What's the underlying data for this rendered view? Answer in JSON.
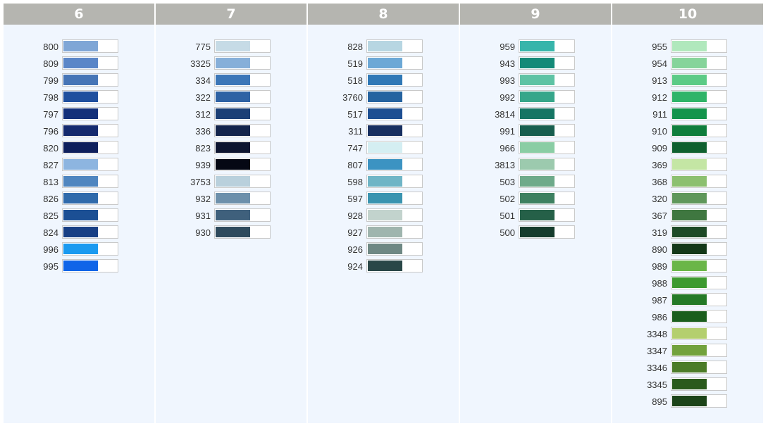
{
  "columns": [
    {
      "title": "6",
      "items": [
        {
          "code": "800",
          "color": "#7fa6d6"
        },
        {
          "code": "809",
          "color": "#5a86c8"
        },
        {
          "code": "799",
          "color": "#4675b6"
        },
        {
          "code": "798",
          "color": "#1f4f9e"
        },
        {
          "code": "797",
          "color": "#13307a"
        },
        {
          "code": "796",
          "color": "#152a6e"
        },
        {
          "code": "820",
          "color": "#0e1f5c"
        },
        {
          "code": "827",
          "color": "#8db5e0"
        },
        {
          "code": "813",
          "color": "#4f86c0"
        },
        {
          "code": "826",
          "color": "#2f6aab"
        },
        {
          "code": "825",
          "color": "#1b4f94"
        },
        {
          "code": "824",
          "color": "#183f84"
        },
        {
          "code": "996",
          "color": "#1a9af0"
        },
        {
          "code": "995",
          "color": "#1065e8"
        }
      ]
    },
    {
      "title": "7",
      "items": [
        {
          "code": "775",
          "color": "#c6dbe6"
        },
        {
          "code": "3325",
          "color": "#86afd9"
        },
        {
          "code": "334",
          "color": "#3b76b8"
        },
        {
          "code": "322",
          "color": "#2e62a4"
        },
        {
          "code": "312",
          "color": "#1b3f76"
        },
        {
          "code": "336",
          "color": "#13244c"
        },
        {
          "code": "823",
          "color": "#0c1430"
        },
        {
          "code": "939",
          "color": "#050814"
        },
        {
          "code": "3753",
          "color": "#b9d0dc"
        },
        {
          "code": "932",
          "color": "#6d90ab"
        },
        {
          "code": "931",
          "color": "#3f607c"
        },
        {
          "code": "930",
          "color": "#2e4a5c"
        }
      ]
    },
    {
      "title": "8",
      "items": [
        {
          "code": "828",
          "color": "#b7d6e2"
        },
        {
          "code": "519",
          "color": "#6ca8d6"
        },
        {
          "code": "518",
          "color": "#2f78b6"
        },
        {
          "code": "3760",
          "color": "#2563a0"
        },
        {
          "code": "517",
          "color": "#1d4f92"
        },
        {
          "code": "311",
          "color": "#172f60"
        },
        {
          "code": "747",
          "color": "#d4eef2"
        },
        {
          "code": "807",
          "color": "#3c93c2"
        },
        {
          "code": "598",
          "color": "#6fb5c6"
        },
        {
          "code": "597",
          "color": "#3a94b0"
        },
        {
          "code": "928",
          "color": "#c2d3cd"
        },
        {
          "code": "927",
          "color": "#9fb5ae"
        },
        {
          "code": "926",
          "color": "#6e8884"
        },
        {
          "code": "924",
          "color": "#2a4748"
        }
      ]
    },
    {
      "title": "9",
      "items": [
        {
          "code": "959",
          "color": "#37b5ab"
        },
        {
          "code": "943",
          "color": "#148a78"
        },
        {
          "code": "993",
          "color": "#5ec3a4"
        },
        {
          "code": "992",
          "color": "#36a68a"
        },
        {
          "code": "3814",
          "color": "#157564"
        },
        {
          "code": "991",
          "color": "#185e4e"
        },
        {
          "code": "966",
          "color": "#8acda4"
        },
        {
          "code": "3813",
          "color": "#9ccaae"
        },
        {
          "code": "503",
          "color": "#6eaa8a"
        },
        {
          "code": "502",
          "color": "#3d8060"
        },
        {
          "code": "501",
          "color": "#256048"
        },
        {
          "code": "500",
          "color": "#153c2c"
        }
      ]
    },
    {
      "title": "10",
      "items": [
        {
          "code": "955",
          "color": "#b0e8bc"
        },
        {
          "code": "954",
          "color": "#86d49a"
        },
        {
          "code": "913",
          "color": "#5ccb86"
        },
        {
          "code": "912",
          "color": "#2fb468"
        },
        {
          "code": "911",
          "color": "#14944c"
        },
        {
          "code": "910",
          "color": "#0f7e3c"
        },
        {
          "code": "909",
          "color": "#0f602e"
        },
        {
          "code": "369",
          "color": "#c4e6a4"
        },
        {
          "code": "368",
          "color": "#8cc070"
        },
        {
          "code": "320",
          "color": "#5f975a"
        },
        {
          "code": "367",
          "color": "#3f7740"
        },
        {
          "code": "319",
          "color": "#1e4a26"
        },
        {
          "code": "890",
          "color": "#143818"
        },
        {
          "code": "989",
          "color": "#6ab648"
        },
        {
          "code": "988",
          "color": "#3d9a2f"
        },
        {
          "code": "987",
          "color": "#257a26"
        },
        {
          "code": "986",
          "color": "#1b5e1c"
        },
        {
          "code": "3348",
          "color": "#b4cf6e"
        },
        {
          "code": "3347",
          "color": "#72a23c"
        },
        {
          "code": "3346",
          "color": "#4c7c28"
        },
        {
          "code": "3345",
          "color": "#2a5a1c"
        },
        {
          "code": "895",
          "color": "#1c4418"
        }
      ]
    }
  ]
}
